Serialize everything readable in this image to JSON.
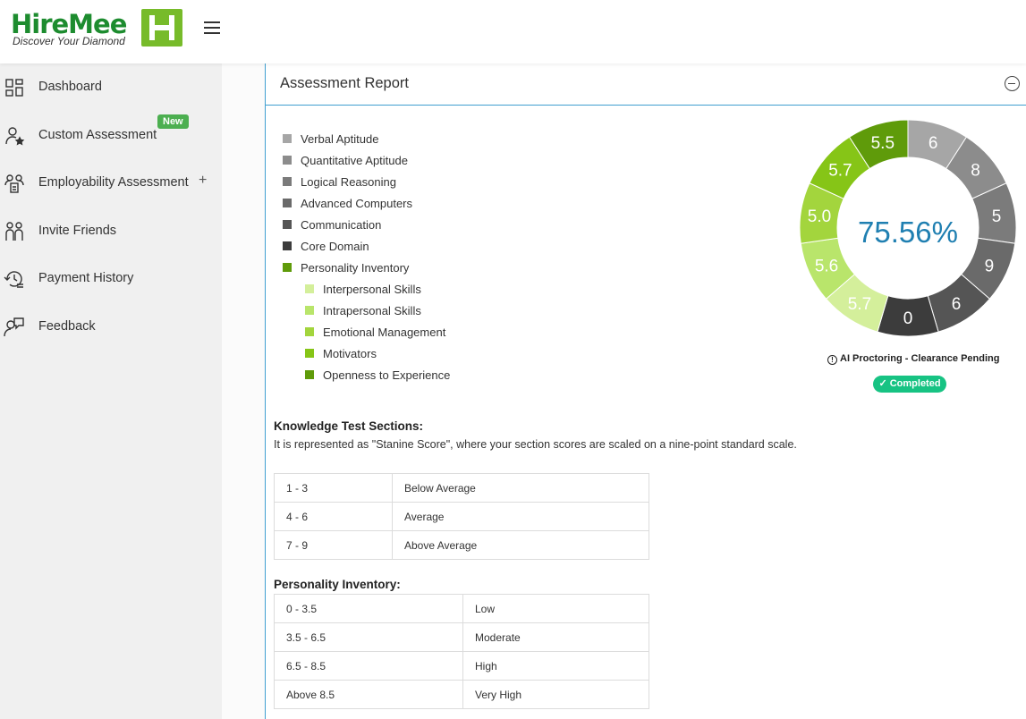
{
  "brand": {
    "name": "HireMee",
    "tagline": "Discover Your Diamond"
  },
  "sidebar": {
    "items": [
      {
        "label": "Dashboard",
        "icon": "dashboard-grid-icon"
      },
      {
        "label": "Custom Assessment",
        "icon": "user-star-icon",
        "badge": "New"
      },
      {
        "label": "Employability Assessment",
        "icon": "users-clipboard-icon",
        "expand": "+"
      },
      {
        "label": "Invite Friends",
        "icon": "people-icon"
      },
      {
        "label": "Payment History",
        "icon": "history-icon"
      },
      {
        "label": "Feedback",
        "icon": "feedback-user-icon"
      }
    ]
  },
  "report": {
    "title": "Assessment Report",
    "score": "75.56%",
    "proctoring": "AI Proctoring - Clearance Pending",
    "status": "Completed"
  },
  "legend": [
    {
      "label": "Verbal Aptitude",
      "color": "#a6a6a6"
    },
    {
      "label": "Quantitative Aptitude",
      "color": "#8c8c8c"
    },
    {
      "label": "Logical Reasoning",
      "color": "#7b7b7b"
    },
    {
      "label": "Advanced Computers",
      "color": "#6a6a6a"
    },
    {
      "label": "Communication",
      "color": "#555555"
    },
    {
      "label": "Core Domain",
      "color": "#3c3c3c"
    },
    {
      "label": "Personality Inventory",
      "color": "#5f9b0a"
    },
    {
      "label": "Interpersonal Skills",
      "color": "#d4ef9b"
    },
    {
      "label": "Intrapersonal Skills",
      "color": "#b9e56b"
    },
    {
      "label": "Emotional Management",
      "color": "#a3d53d"
    },
    {
      "label": "Motivators",
      "color": "#86c517"
    },
    {
      "label": "Openness to Experience",
      "color": "#5f9b0a"
    }
  ],
  "chart_data": {
    "type": "pie",
    "categories": [
      "Verbal Aptitude",
      "Quantitative Aptitude",
      "Logical Reasoning",
      "Advanced Computers",
      "Communication",
      "Core Domain",
      "Interpersonal Skills",
      "Intrapersonal Skills",
      "Emotional Management",
      "Motivators",
      "Openness to Experience"
    ],
    "values": [
      6,
      8,
      5,
      9,
      6,
      0,
      5.7,
      5.6,
      5.0,
      5.7,
      5.5
    ],
    "labels": [
      "6",
      "8",
      "5",
      "9",
      "6",
      "0",
      "5.7",
      "5.6",
      "5.0",
      "5.7",
      "5.5"
    ],
    "colors": [
      "#a6a6a6",
      "#8c8c8c",
      "#7b7b7b",
      "#6a6a6a",
      "#555555",
      "#3c3c3c",
      "#d4ef9b",
      "#b9e56b",
      "#a3d53d",
      "#86c517",
      "#5f9b0a"
    ],
    "center_text": "75.56%",
    "note": "equal-width donut segments, one per section"
  },
  "knowledge": {
    "title": "Knowledge Test Sections:",
    "desc": "It is represented as \"Stanine Score\", where your section scores are scaled on a nine-point standard scale.",
    "rows": [
      [
        "1 - 3",
        "Below Average"
      ],
      [
        "4 - 6",
        "Average"
      ],
      [
        "7 - 9",
        "Above Average"
      ]
    ]
  },
  "personality": {
    "title": "Personality Inventory:",
    "rows": [
      [
        "0 - 3.5",
        "Low"
      ],
      [
        "3.5 - 6.5",
        "Moderate"
      ],
      [
        "6.5 - 8.5",
        "High"
      ],
      [
        "Above 8.5",
        "Very High"
      ]
    ]
  }
}
